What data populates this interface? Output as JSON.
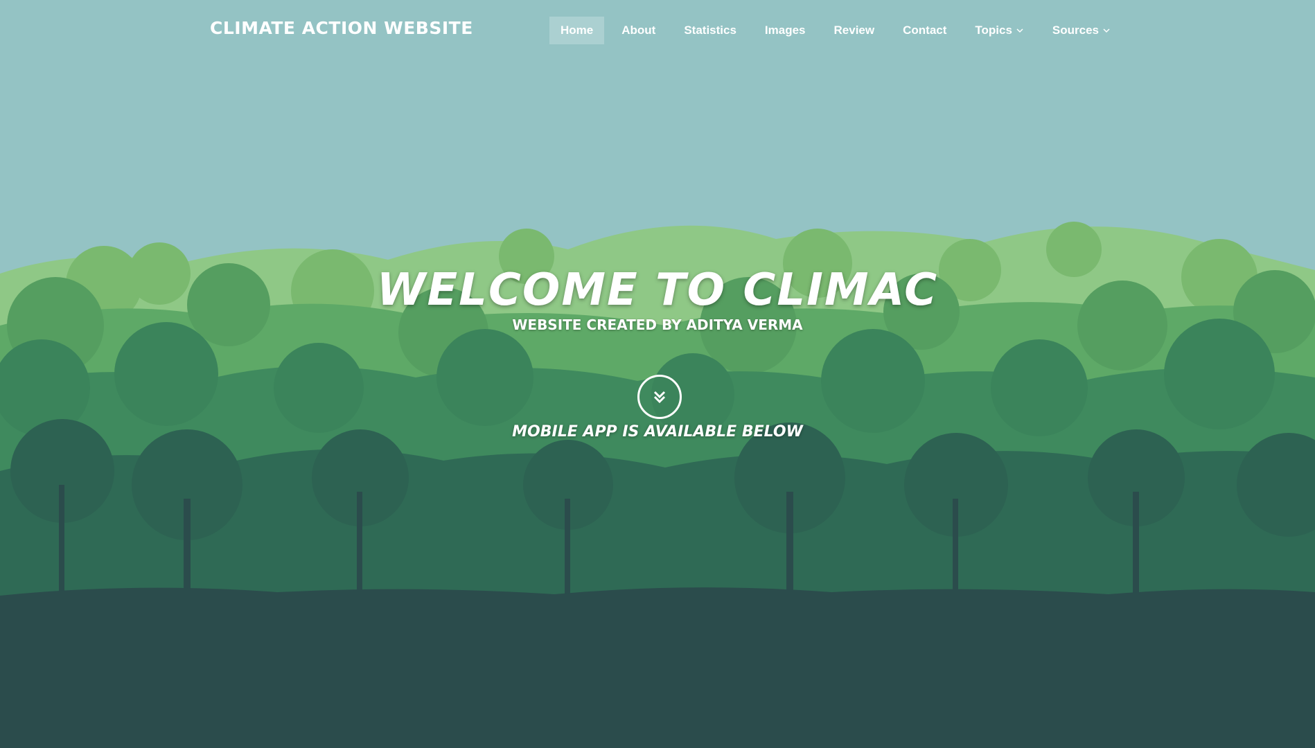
{
  "header": {
    "brand": "CLIMATE ACTION WEBSITE",
    "nav": [
      {
        "label": "Home",
        "active": true
      },
      {
        "label": "About"
      },
      {
        "label": "Statistics"
      },
      {
        "label": "Images"
      },
      {
        "label": "Review"
      },
      {
        "label": "Contact"
      },
      {
        "label": "Topics",
        "dropdown": true
      },
      {
        "label": "Sources",
        "dropdown": true
      }
    ]
  },
  "hero": {
    "title": "WELCOME TO CLIMAC",
    "subtitle": "WEBSITE CREATED BY ADITYA VERMA",
    "scroll_icon": "double-chevron-down-icon",
    "note": "MOBILE APP IS AVAILABLE BELOW"
  },
  "colors": {
    "sky": "#94c3c4",
    "hill_light": "#7fbf75",
    "hill_mid": "#5fa866",
    "forest_mid": "#3f8a5e",
    "forest_dark": "#2f6a55",
    "ground": "#2b4c4c",
    "text": "#ffffff"
  }
}
